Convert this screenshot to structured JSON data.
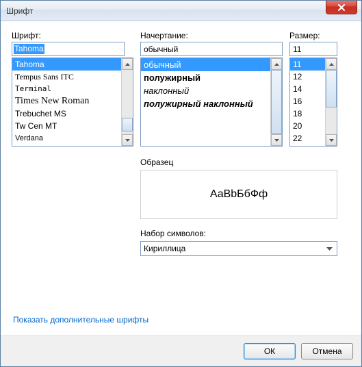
{
  "window": {
    "title": "Шрифт"
  },
  "labels": {
    "font": "Шрифт:",
    "style": "Начертание:",
    "size": "Размер:",
    "sample": "Образец",
    "charset": "Набор символов:"
  },
  "font": {
    "value": "Tahoma",
    "items": [
      "Tahoma",
      "Tempus Sans ITC",
      "Terminal",
      "Times New Roman",
      "Trebuchet MS",
      "Tw Cen MT",
      "Verdana"
    ],
    "selected_index": 0
  },
  "style": {
    "value": "обычный",
    "items": [
      {
        "label": "обычный",
        "variant": "regular"
      },
      {
        "label": "полужирный",
        "variant": "bold"
      },
      {
        "label": "наклонный",
        "variant": "italic"
      },
      {
        "label": "полужирный наклонный",
        "variant": "bolditalic"
      }
    ],
    "selected_index": 0
  },
  "size": {
    "value": "11",
    "items": [
      "11",
      "12",
      "14",
      "16",
      "18",
      "20",
      "22"
    ],
    "selected_index": 0
  },
  "sample": {
    "text": "АаВbБбФф"
  },
  "charset": {
    "value": "Кириллица"
  },
  "link": {
    "label": "Показать дополнительные шрифты"
  },
  "buttons": {
    "ok": "ОК",
    "cancel": "Отмена"
  }
}
